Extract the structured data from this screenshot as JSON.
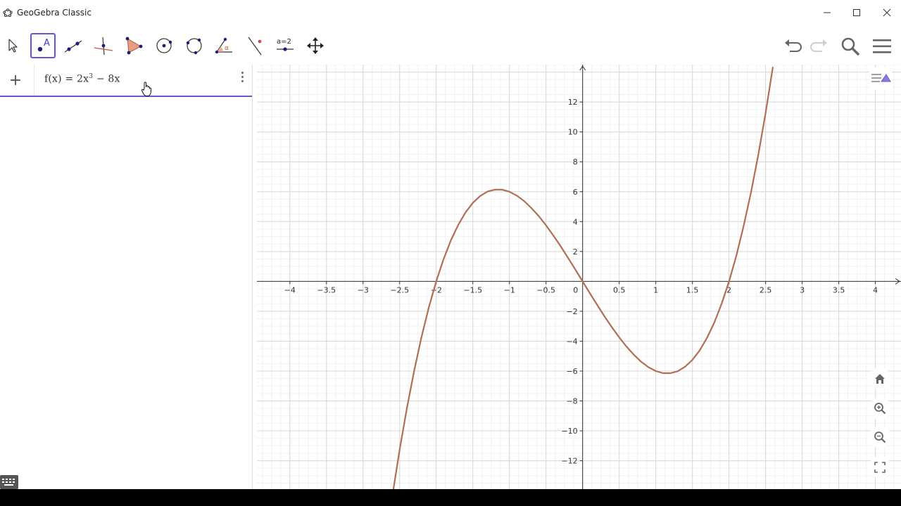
{
  "window": {
    "title": "GeoGebra Classic",
    "controls": [
      "minimize-icon",
      "maximize-icon",
      "close-icon"
    ]
  },
  "toolbar": {
    "tools": [
      {
        "name": "move-tool",
        "icon": "arrow-pointer-icon"
      },
      {
        "name": "point-tool",
        "icon": "point-a-icon",
        "label": "A",
        "active": true
      },
      {
        "name": "line-tool",
        "icon": "line-through-points-icon"
      },
      {
        "name": "perpendicular-line-tool",
        "icon": "perpendicular-icon"
      },
      {
        "name": "polygon-tool",
        "icon": "polygon-icon"
      },
      {
        "name": "circle-tool",
        "icon": "circle-center-point-icon"
      },
      {
        "name": "circle-through-points-tool",
        "icon": "circle-three-points-icon"
      },
      {
        "name": "angle-tool",
        "icon": "angle-icon",
        "label": "α"
      },
      {
        "name": "reflect-tool",
        "icon": "reflect-about-line-icon"
      },
      {
        "name": "slider-tool",
        "icon": "slider-icon",
        "label": "a=2"
      },
      {
        "name": "move-graphics-view-tool",
        "icon": "move-view-icon"
      }
    ],
    "right": [
      "undo-icon",
      "redo-icon",
      "search-icon",
      "menu-icon"
    ]
  },
  "algebra": {
    "add_label": "+",
    "expression": {
      "prefix": "f(x)  =  2x",
      "exponent": "3",
      "suffix": " − 8x"
    }
  },
  "graphics": {
    "view_buttons": [
      "home-icon",
      "zoom-in-icon",
      "zoom-out-icon",
      "fullscreen-icon"
    ],
    "style_bar_icon": "style-bar-toggle-icon"
  },
  "chart_data": {
    "type": "line",
    "function": "f(x) = 2x^3 - 8x",
    "xlim": [
      -4.45,
      4.35
    ],
    "ylim": [
      -13.9,
      14.5
    ],
    "grid": true,
    "x_ticks": [
      "-4",
      "-3.5",
      "-3",
      "-2.5",
      "-2",
      "-1.5",
      "-1",
      "-0.5",
      "0",
      "0.5",
      "1",
      "1.5",
      "2",
      "2.5",
      "3",
      "3.5",
      "4"
    ],
    "y_ticks": [
      "12",
      "10",
      "8",
      "6",
      "4",
      "2",
      "-2",
      "-4",
      "-6",
      "-8",
      "-10",
      "-12"
    ],
    "series": [
      {
        "color": "#b06e55",
        "x": [
          -2.6,
          -2.5,
          -2.4,
          -2.3,
          -2.2,
          -2.1,
          -2.0,
          -1.9,
          -1.8,
          -1.7,
          -1.6,
          -1.5,
          -1.4,
          -1.3,
          -1.2,
          -1.1,
          -1.0,
          -0.9,
          -0.8,
          -0.7,
          -0.6,
          -0.5,
          -0.4,
          -0.3,
          -0.2,
          -0.1,
          0.0,
          0.1,
          0.2,
          0.3,
          0.4,
          0.5,
          0.6,
          0.7,
          0.8,
          0.9,
          1.0,
          1.1,
          1.2,
          1.3,
          1.4,
          1.5,
          1.6,
          1.7,
          1.8,
          1.9,
          2.0,
          2.1,
          2.2,
          2.3,
          2.4,
          2.5,
          2.6
        ],
        "y": [
          -14.35,
          -11.25,
          -8.45,
          -5.93,
          -3.7,
          -1.72,
          0.0,
          1.48,
          2.74,
          3.77,
          4.61,
          5.25,
          5.71,
          6.01,
          6.14,
          6.14,
          6.0,
          5.74,
          5.38,
          4.91,
          4.37,
          3.75,
          3.07,
          2.35,
          1.58,
          0.8,
          0.0,
          -0.8,
          -1.58,
          -2.35,
          -3.07,
          -3.75,
          -4.37,
          -4.91,
          -5.38,
          -5.74,
          -6.0,
          -6.14,
          -6.14,
          -6.01,
          -5.71,
          -5.25,
          -4.61,
          -3.77,
          -2.74,
          -1.48,
          0.0,
          1.72,
          3.7,
          5.93,
          8.45,
          11.25,
          14.35
        ]
      }
    ]
  }
}
